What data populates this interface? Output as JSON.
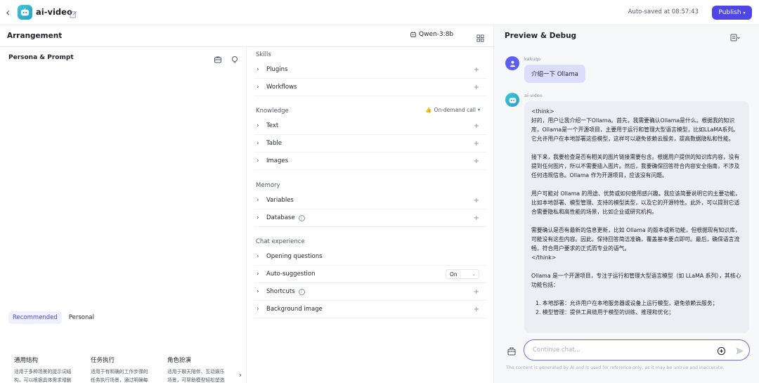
{
  "header": {
    "app_name": "ai-video",
    "autosave": "Auto-saved at 08:57:43",
    "publish_label": "Publish"
  },
  "arrangement": {
    "title": "Arrangement",
    "model": "Qwen-3:8b"
  },
  "persona": {
    "title": "Persona & Prompt",
    "tabs": [
      "Recommended",
      "Personal"
    ],
    "templates": [
      {
        "title": "通用结构",
        "desc": "适用于多种场景的提示词结构，可以根据具体需求增删对应模块"
      },
      {
        "title": "任务执行",
        "desc": "适用于有明确的工作步骤的任务执行场景，通过明确每一步骤的工作要求..."
      },
      {
        "title": "角色扮演",
        "desc": "适用于聊天陪伴、互动娱乐场景，可帮助模型轻松塑造个性化的人物角色..."
      }
    ]
  },
  "skills": {
    "sections": {
      "skills": "Skills",
      "knowledge": "Knowledge",
      "memory": "Memory",
      "chat": "Chat experience"
    },
    "ondemand": "On-demand call",
    "items": {
      "plugins": "Plugins",
      "workflows": "Workflows",
      "text": "Text",
      "table": "Table",
      "images": "Images",
      "variables": "Variables",
      "database": "Database",
      "opening": "Opening questions",
      "autosuggest": "Auto-suggestion",
      "autosuggest_value": "On",
      "shortcuts": "Shortcuts",
      "background": "Background image"
    }
  },
  "preview": {
    "title": "Preview & Debug",
    "user_name": "kakuqo",
    "user_message": "介绍一下 Ollama",
    "bot_name": "ai-video",
    "bot_paragraphs": [
      "<think>\n好的，用户让我介绍一下Ollama。首先，我需要确认Ollama是什么。根据我的知识库，Ollama是一个开源项目，主要用于运行和管理大型语言模型，比如LLaMA系列。它允许用户在本地部署这些模型，这样可以避免依赖云服务，提高数据隐私和性能。",
      "接下来，我要检查是否有相关的图片链接需要包含。根据用户提供的知识库内容，没有提到任何图片，所以不需要插入图片。然后，我要确保回答符合内容安全指南，不涉及任何违规信息。Ollama 作为开源项目，应该没有问题。",
      "用户可能对 Ollama 的用途、优势或如何使用感兴趣。我应该简要说明它的主要功能，比如本地部署、模型管理、支持的模型类型，以及它的开源特性。此外，可以提到它适合需要隐私和高性能的场景，比如企业或研究机构。",
      "需要确认是否有最新的信息更新，比如 Ollama 的版本或新功能，但根据现有知识库，可能没有这些内容。因此，保持回答简洁准确，覆盖基本要点即可。最后，确保语言流畅，符合用户要求的正式而专业的语气。\n</think>",
      "Ollama 是一个开源项目，专注于运行和管理大型语言模型（如 LLaMA 系列），其核心功能包括：",
      "1. 本地部署：允许用户在本地服务器或设备上运行模型，避免依赖云服务；",
      "2. 模型管理：提供工具链用于模型的训练、推理和优化；"
    ],
    "input_placeholder": "Continue chat...",
    "disclaimer": "The content is generated by AI and is used for reference only, as it may be untrue and inaccurate."
  },
  "colors": {
    "accent": "#4f46e5",
    "user_bubble": "#dcdcfc",
    "bot_bubble": "#eceef3"
  }
}
